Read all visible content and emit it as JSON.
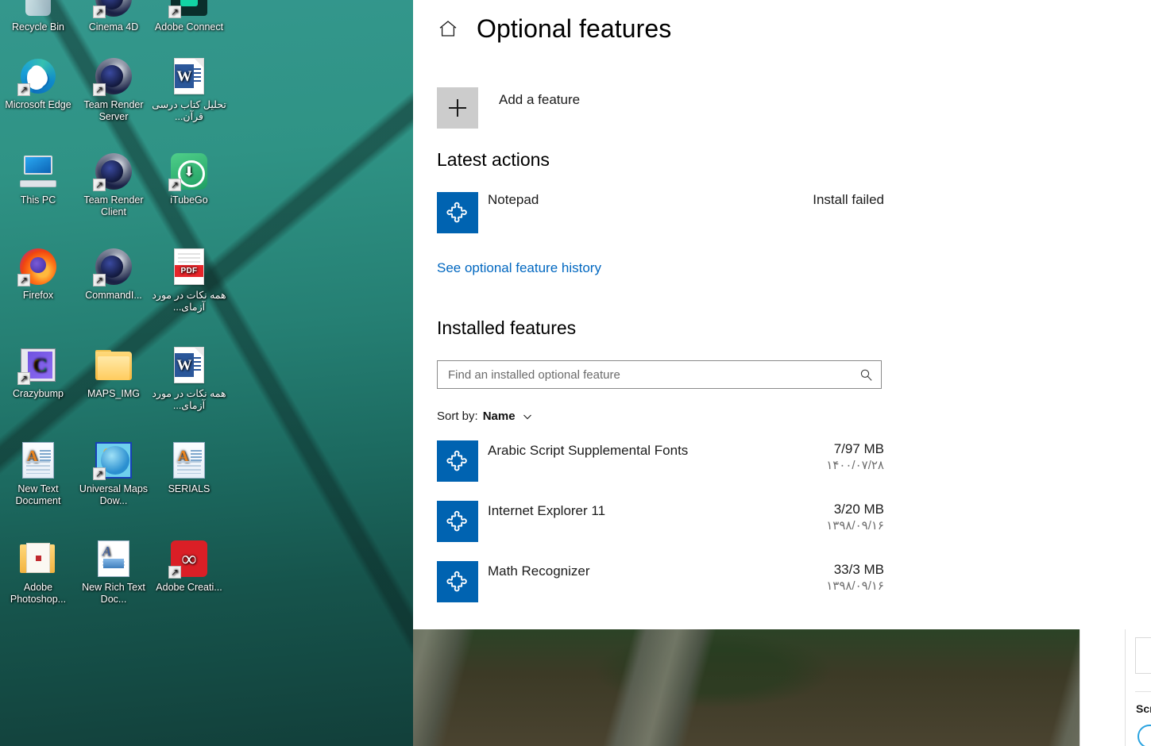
{
  "theme": {
    "accent": "#0063b1",
    "link": "#0067c0"
  },
  "desktop": {
    "icons": [
      {
        "label": "Recycle Bin",
        "art": "recycle",
        "shortcut": false,
        "rtl": false
      },
      {
        "label": "Cinema 4D",
        "art": "c4d",
        "shortcut": true,
        "rtl": false
      },
      {
        "label": "Adobe Connect",
        "art": "ac",
        "shortcut": true,
        "rtl": false
      },
      {
        "label": "Microsoft Edge",
        "art": "edge",
        "shortcut": true,
        "rtl": false
      },
      {
        "label": "Team Render Server",
        "art": "c4d",
        "shortcut": true,
        "rtl": false
      },
      {
        "label": "تحلیل کتاب درسی قرآن...",
        "art": "word",
        "shortcut": false,
        "rtl": true
      },
      {
        "label": "This PC",
        "art": "pc",
        "shortcut": false,
        "rtl": false
      },
      {
        "label": "Team Render Client",
        "art": "c4d",
        "shortcut": true,
        "rtl": false
      },
      {
        "label": "iTubeGo",
        "art": "tube",
        "shortcut": true,
        "rtl": false
      },
      {
        "label": "Firefox",
        "art": "firefox",
        "shortcut": true,
        "rtl": false
      },
      {
        "label": "CommandI...",
        "art": "c4d",
        "shortcut": true,
        "rtl": false
      },
      {
        "label": "همه نکات در مورد آزمای...",
        "art": "pdf",
        "shortcut": false,
        "rtl": true
      },
      {
        "label": "Crazybump",
        "art": "crazy",
        "shortcut": true,
        "rtl": false
      },
      {
        "label": "MAPS_IMG",
        "art": "folder",
        "shortcut": false,
        "rtl": false
      },
      {
        "label": "همه نکات در مورد آزمای...",
        "art": "word",
        "shortcut": false,
        "rtl": true
      },
      {
        "label": "New Text Document",
        "art": "txt",
        "shortcut": false,
        "rtl": false
      },
      {
        "label": "Universal Maps Dow...",
        "art": "globe",
        "shortcut": true,
        "rtl": false
      },
      {
        "label": "SERIALS",
        "art": "txt",
        "shortcut": false,
        "rtl": false
      },
      {
        "label": "Adobe Photoshop...",
        "art": "psfolder",
        "shortcut": false,
        "rtl": false
      },
      {
        "label": "New Rich Text Doc...",
        "art": "rtf",
        "shortcut": false,
        "rtl": false
      },
      {
        "label": "Adobe Creati...",
        "art": "cc",
        "shortcut": true,
        "rtl": false
      }
    ]
  },
  "settings": {
    "home_icon": "home-icon",
    "title": "Optional features",
    "add_feature": {
      "label": "Add a feature",
      "icon": "plus-icon"
    },
    "latest_actions": {
      "heading": "Latest actions",
      "items": [
        {
          "name": "Notepad",
          "status": "Install failed",
          "icon": "puzzle-piece-icon",
          "progress": 100
        }
      ],
      "history_link": "See optional feature history"
    },
    "installed": {
      "heading": "Installed features",
      "search": {
        "placeholder": "Find an installed optional feature",
        "value": "",
        "icon": "search-icon"
      },
      "sort": {
        "label": "Sort by:",
        "value": "Name",
        "icon": "chevron-down-icon"
      },
      "items": [
        {
          "name": "Arabic Script Supplemental Fonts",
          "size": "7/97 MB",
          "date": "۱۴۰۰/۰۷/۲۸",
          "icon": "puzzle-piece-icon"
        },
        {
          "name": "Internet Explorer 11",
          "size": "3/20 MB",
          "date": "۱۳۹۸/۰۹/۱۶",
          "icon": "puzzle-piece-icon"
        },
        {
          "name": "Math Recognizer",
          "size": "33/3 MB",
          "date": "۱۳۹۸/۰۹/۱۶",
          "icon": "puzzle-piece-icon"
        }
      ]
    }
  },
  "edge_window": {
    "button_icon": "download-icon",
    "section_label": "Scr"
  }
}
